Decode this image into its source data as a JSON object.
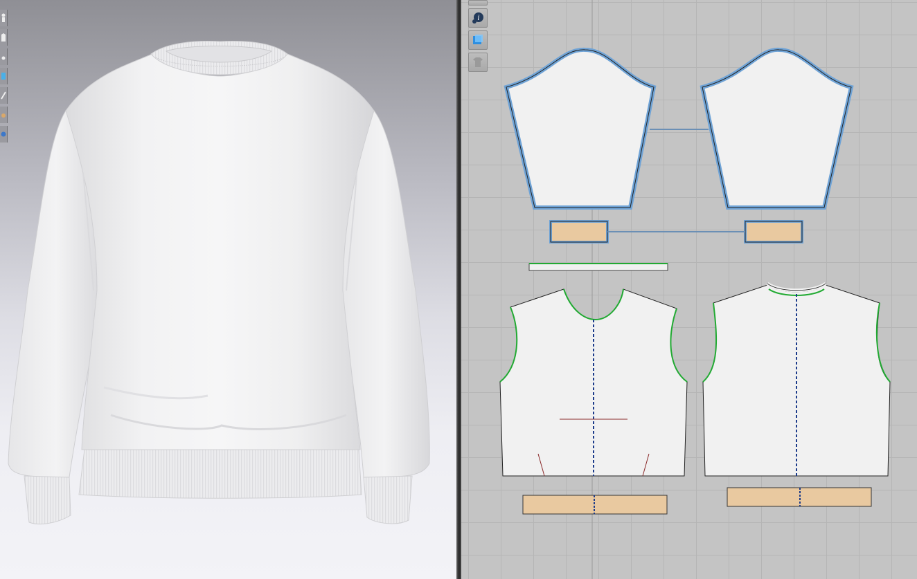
{
  "window": {
    "title": ""
  },
  "viewports": {
    "avatar_3d": {
      "background_top": "#8f8f95",
      "background_bottom": "#f3f3f7"
    },
    "pattern_2d": {
      "background": "#c4c4c4",
      "grid": "#b5b5b5"
    }
  },
  "toolbar_3d": {
    "tools": [
      {
        "icon": "avatar-icon"
      },
      {
        "icon": "garment-icon"
      },
      {
        "icon": "pin-icon"
      },
      {
        "icon": "fold-icon"
      },
      {
        "icon": "texture-icon"
      },
      {
        "icon": "tape-icon"
      },
      {
        "icon": "globe-icon"
      }
    ]
  },
  "toolbar_2d": {
    "tools": [
      {
        "icon": "partial-tool-icon"
      },
      {
        "icon": "info-icon"
      },
      {
        "icon": "show-piece-icon"
      },
      {
        "icon": "lock-shirt-icon"
      }
    ]
  },
  "garment": {
    "name": "",
    "fabric_color": "#f1f1f1",
    "selected_outline": "#6fa3d6",
    "ribbing_color": "#e9c9a0"
  }
}
